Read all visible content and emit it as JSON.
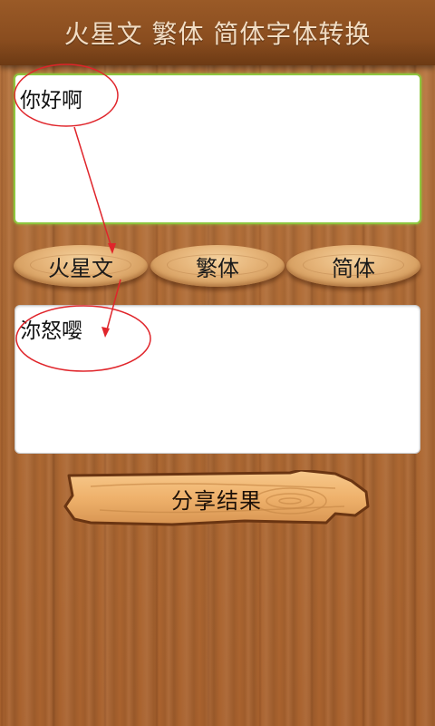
{
  "app": {
    "title": "火星文 繁体 简体字体转换"
  },
  "input": {
    "value": "你好啊"
  },
  "buttons": {
    "martian": "火星文",
    "traditional": "繁体",
    "simplified": "简体"
  },
  "output": {
    "value": "沵怒嘤"
  },
  "share": {
    "label": "分享结果"
  },
  "colors": {
    "input_border": "#8ec63f",
    "annotation": "#e0252b",
    "titlebar": "#8a4d1f"
  }
}
